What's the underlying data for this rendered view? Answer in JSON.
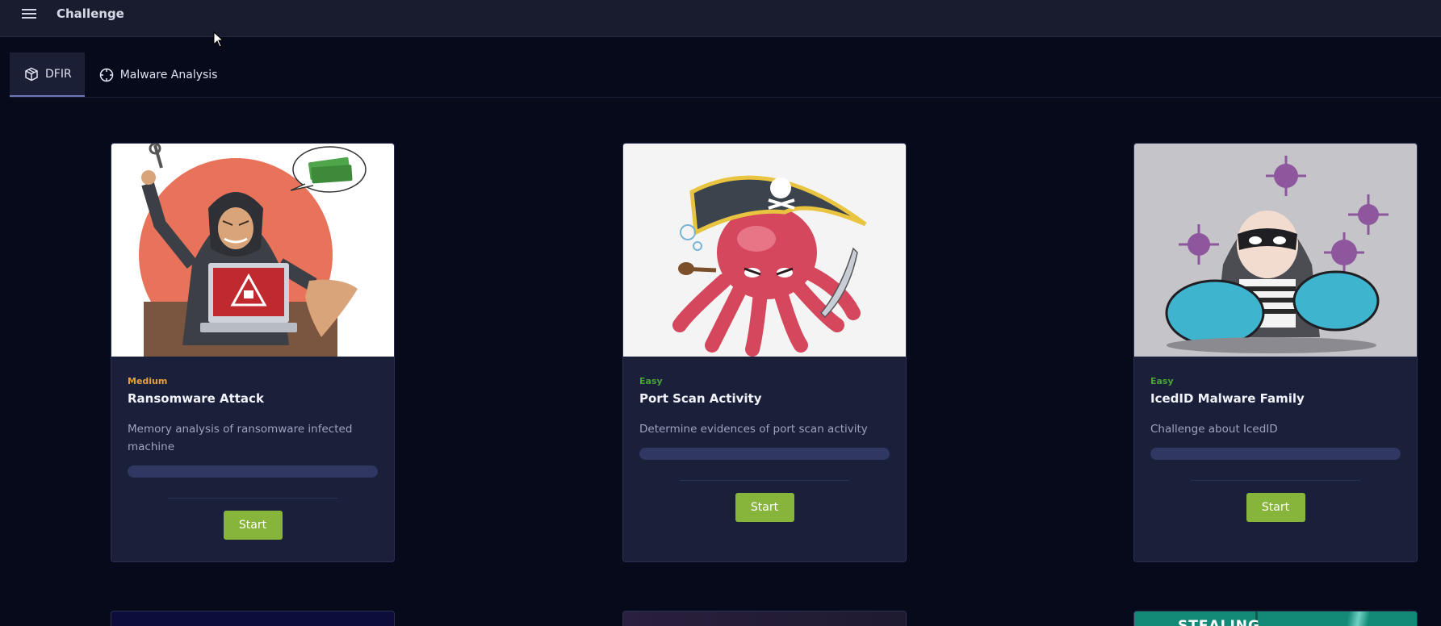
{
  "app": {
    "title": "Challenge"
  },
  "tabs": [
    {
      "label": "DFIR",
      "icon": "cube-icon",
      "active": true
    },
    {
      "label": "Malware Analysis",
      "icon": "crosshair-icon",
      "active": false
    }
  ],
  "cards": [
    {
      "difficulty": "Medium",
      "difficulty_color": "#e7a13c",
      "title": "Ransomware Attack",
      "description": "Memory analysis of ransomware infected machine",
      "progress": 0,
      "button": "Start"
    },
    {
      "difficulty": "Easy",
      "difficulty_color": "#4aa23a",
      "title": "Port Scan Activity",
      "description": "Determine evidences of port scan activity",
      "progress": 0,
      "button": "Start"
    },
    {
      "difficulty": "Easy",
      "difficulty_color": "#4aa23a",
      "title": "IcedID Malware Family",
      "description": "Challenge about IcedID",
      "progress": 0,
      "button": "Start"
    }
  ],
  "next_row": {
    "partial_text": "STEALING"
  },
  "colors": {
    "background": "#070a1a",
    "topbar": "#181c2e",
    "card": "#1a1f3a",
    "accent_button": "#87b43a",
    "progress_track": "#2f3762"
  }
}
